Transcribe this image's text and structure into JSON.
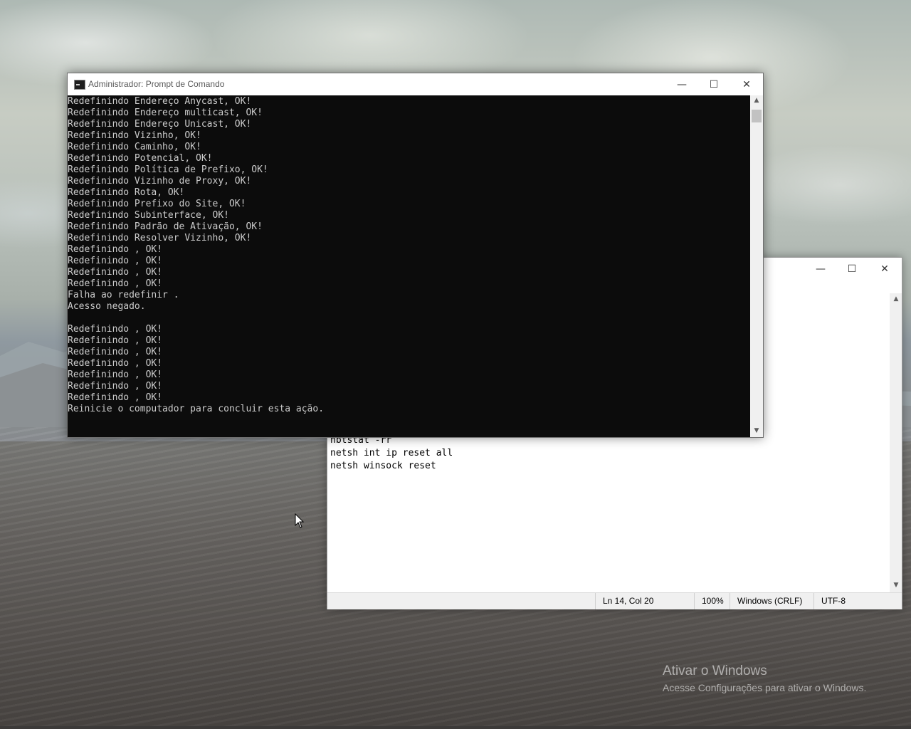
{
  "cmd": {
    "title": "Administrador: Prompt de Comando",
    "lines": [
      "Redefinindo Endereço Anycast, OK!",
      "Redefinindo Endereço multicast, OK!",
      "Redefinindo Endereço Unicast, OK!",
      "Redefinindo Vizinho, OK!",
      "Redefinindo Caminho, OK!",
      "Redefinindo Potencial, OK!",
      "Redefinindo Política de Prefixo, OK!",
      "Redefinindo Vizinho de Proxy, OK!",
      "Redefinindo Rota, OK!",
      "Redefinindo Prefixo do Site, OK!",
      "Redefinindo Subinterface, OK!",
      "Redefinindo Padrão de Ativação, OK!",
      "Redefinindo Resolver Vizinho, OK!",
      "Redefinindo , OK!",
      "Redefinindo , OK!",
      "Redefinindo , OK!",
      "Redefinindo , OK!",
      "Falha ao redefinir .",
      "Acesso negado.",
      "",
      "Redefinindo , OK!",
      "Redefinindo , OK!",
      "Redefinindo , OK!",
      "Redefinindo , OK!",
      "Redefinindo , OK!",
      "Redefinindo , OK!",
      "Redefinindo , OK!",
      "Reinicie o computador para concluir esta ação."
    ],
    "minimize_glyph": "—",
    "maximize_glyph": "☐",
    "close_glyph": "✕"
  },
  "notepad": {
    "visible_lines": [
      "nbtstat -rr",
      "netsh int ip reset all",
      "netsh winsock reset"
    ],
    "status": {
      "position": "Ln 14, Col 20",
      "zoom": "100%",
      "line_ending": "Windows (CRLF)",
      "encoding": "UTF-8"
    },
    "minimize_glyph": "—",
    "maximize_glyph": "☐",
    "close_glyph": "✕"
  },
  "watermark": {
    "title": "Ativar o Windows",
    "subtitle": "Acesse Configurações para ativar o Windows."
  }
}
